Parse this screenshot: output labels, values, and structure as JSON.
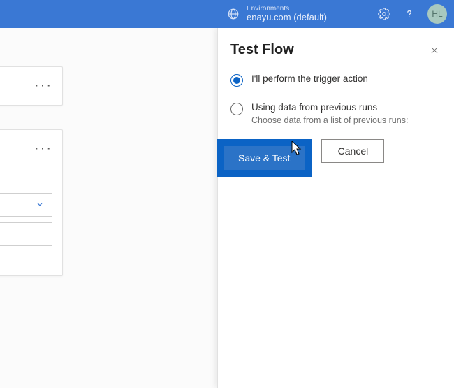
{
  "topbar": {
    "env_label": "Environments",
    "env_value": "enayu.com (default)",
    "avatar_initials": "HL"
  },
  "panel": {
    "title": "Test Flow",
    "radio1_label": "I'll perform the trigger action",
    "radio2_label": "Using data from previous runs",
    "radio2_sub": "Choose data from a list of previous runs:",
    "save_test_label": "Save & Test",
    "cancel_label": "Cancel"
  }
}
